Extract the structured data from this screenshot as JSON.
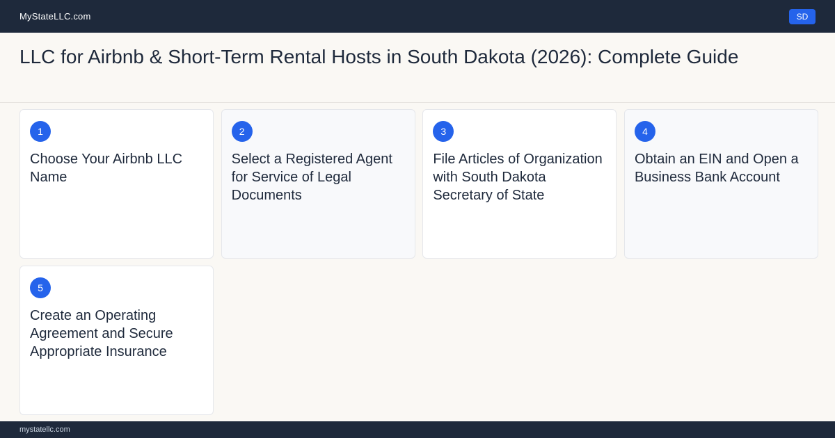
{
  "header": {
    "brand": "MyStateLLC.com",
    "state_badge": "SD"
  },
  "page": {
    "title": "LLC for Airbnb & Short-Term Rental Hosts in South Dakota (2026): Complete Guide"
  },
  "steps": [
    {
      "number": "1",
      "text": "Choose Your Airbnb LLC Name"
    },
    {
      "number": "2",
      "text": "Select a Registered Agent for Service of Legal Documents"
    },
    {
      "number": "3",
      "text": "File Articles of Organization with South Dakota Secretary of State"
    },
    {
      "number": "4",
      "text": "Obtain an EIN and Open a Business Bank Account"
    },
    {
      "number": "5",
      "text": "Create an Operating Agreement and Secure Appropriate Insurance"
    }
  ],
  "footer": {
    "domain": "mystatellc.com"
  },
  "colors": {
    "header_bg": "#1e293b",
    "accent": "#2563eb",
    "page_bg": "#faf8f4"
  }
}
